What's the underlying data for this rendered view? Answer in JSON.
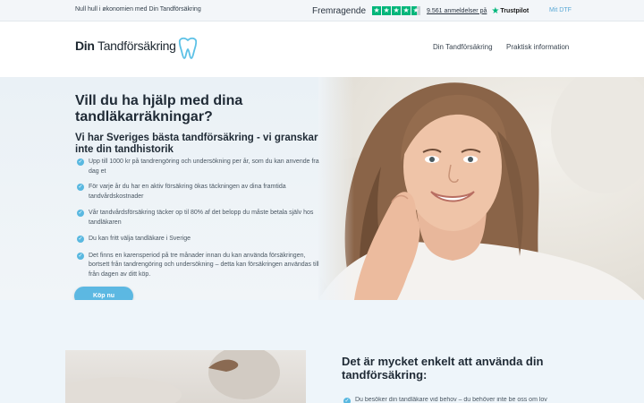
{
  "topbar": {
    "tagline": "Null hull i økonomien med Din Tandförsäkring",
    "trustpilot": {
      "rating_label": "Fremragende",
      "stars": 4.5,
      "reviews": "9.561 anmeldelser på",
      "brand": "Trustpilot",
      "brand_color": "#00b67a"
    },
    "my_link": "Mit DTF"
  },
  "header": {
    "logo": {
      "text_bold": "Din",
      "text_rest": " Tandförsäkring",
      "icon": "tooth-icon",
      "icon_color": "#5cc1e6"
    },
    "nav": [
      "Din Tandförsäkring",
      "Praktisk information"
    ]
  },
  "hero": {
    "title": "Vill du ha hjälp med dina tandläkarräkningar?",
    "subtitle": "Vi har Sveriges bästa tandförsäkring - vi granskar inte din tandhistorik",
    "bullets": [
      "Upp till 1000 kr på tandrengöring och undersökning per år, som du kan anvende fra dag et",
      "För varje år du har en aktiv försäkring ökas täckningen av dina framtida tandvårdskostnader",
      "Vår tandvårdsförsäkring täcker op til 80% af det belopp du måste betala själv hos tandläkaren",
      "Du kan fritt välja tandläkare i Sverige",
      "Det finns en karensperiod på tre månader innan du kan använda försäkringen, bortsett från tandrengöring och undersökning – detta kan försäkringen användas till från dagen av ditt köp."
    ],
    "cta": "Köp nu",
    "accent": "#5cb8e2"
  },
  "section2": {
    "title": "Det är mycket enkelt att använda din tandförsäkring:",
    "first_item": "Du besöker din tandläkare vid behov – du behöver inte be oss om lov"
  }
}
